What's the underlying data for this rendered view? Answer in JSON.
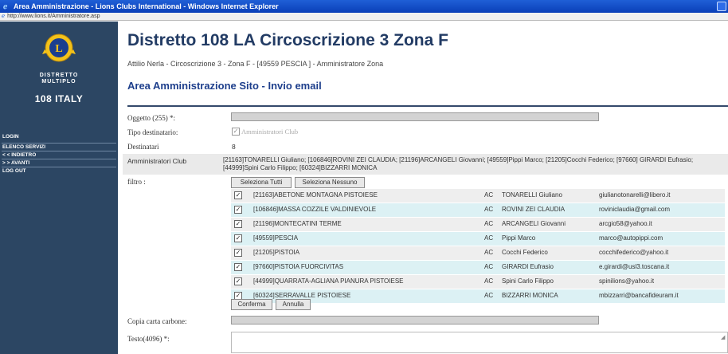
{
  "window": {
    "title": "Area Amministrazione - Lions Clubs International - Windows Internet Explorer",
    "url": "http://www.lions.it/Amministratore.asp"
  },
  "sidebar": {
    "logo_small_line1": "DISTRETTO",
    "logo_small_line2": "MULTIPLO",
    "logo_big": "108 ITALY",
    "nav": [
      "LOGIN",
      "ELENCO SERVIZI",
      "< < INDIETRO",
      "> > AVANTI",
      "LOG OUT"
    ]
  },
  "header": {
    "title": "Distretto 108 LA Circoscrizione 3 Zona F",
    "subtitle": "Attilio Nerla - Circoscrizione 3 - Zona F - [49559 PESCIA ] - Amministratore Zona",
    "section_title": "Area Amministrazione Sito - Invio email"
  },
  "form": {
    "oggetto_label": "Oggetto (255) *:",
    "oggetto_value": "",
    "tipo_label": "Tipo destinatario:",
    "tipo_option": "Amministratori Club",
    "destinatari_label": "Destinatari",
    "destinatari_value": "8",
    "admin_label": "Amministratori Club",
    "admin_value": "[21163]TONARELLI Giuliano; [106846]ROVINI ZEI CLAUDIA; [21196]ARCANGELI Giovanni; [49559]Pippi Marco; [21205]Cocchi Federico; [97660] GIRARDI Eufrasio; [44999]Spini Carlo Filippo; [60324]BIZZARRI MONICA",
    "filtro_label": "filtro :",
    "select_all": "Seleziona Tutti",
    "select_none": "Seleziona Nessuno",
    "confirm": "Conferma",
    "cancel": "Annulla",
    "copia_label": "Copia carta carbone:",
    "copia_value": "",
    "testo_label": "Testo(4096) *:",
    "testo_value": ""
  },
  "clubs": [
    {
      "checked": true,
      "name": "[21163]ABETONE MONTAGNA PISTOIESE",
      "role": "AC",
      "person": "TONARELLI Giuliano",
      "email": "giulianotonarelli@libero.it"
    },
    {
      "checked": true,
      "name": "[106846]MASSA COZZILE VALDINIEVOLE",
      "role": "AC",
      "person": "ROVINI ZEI CLAUDIA",
      "email": "roviniclaudia@gmail.com"
    },
    {
      "checked": true,
      "name": "[21196]MONTECATINI TERME",
      "role": "AC",
      "person": "ARCANGELI Giovanni",
      "email": "arcgio58@yahoo.it"
    },
    {
      "checked": true,
      "name": "[49559]PESCIA",
      "role": "AC",
      "person": "Pippi Marco",
      "email": "marco@autopippi.com"
    },
    {
      "checked": true,
      "name": "[21205]PISTOIA",
      "role": "AC",
      "person": "Cocchi Federico",
      "email": "cocchifederico@yahoo.it"
    },
    {
      "checked": true,
      "name": "[97660]PISTOIA FUORCIVITAS",
      "role": "AC",
      "person": "GIRARDI Eufrasio",
      "email": "e.girardi@usl3.toscana.it"
    },
    {
      "checked": true,
      "name": "[44999]QUARRATA-AGLIANA PIANURA PISTOIESE",
      "role": "AC",
      "person": "Spini Carlo Filippo",
      "email": "spinilions@yahoo.it"
    },
    {
      "checked": true,
      "name": "[60324]SERRAVALLE PISTOIESE",
      "role": "AC",
      "person": "BIZZARRI MONICA",
      "email": "mbizzarri@bancafideuram.it"
    }
  ]
}
